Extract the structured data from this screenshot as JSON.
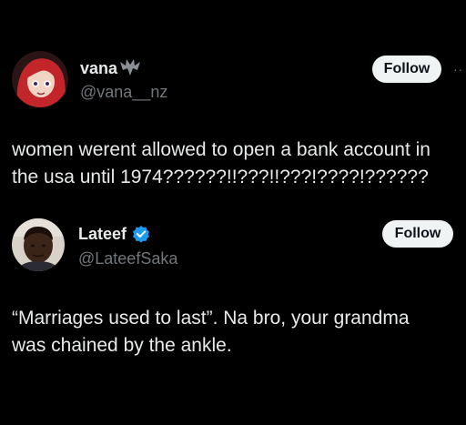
{
  "tweets": [
    {
      "name": "vana",
      "handle": "@vana__nz",
      "follow_label": "Follow",
      "text_line1": "women werent allowed to open a bank account in",
      "text_line2": "the usa until 1974??????!!???!!???!????!??????",
      "badge_icon": "bat-emoji-icon",
      "avatar_icon": "anime-avatar-red-hair"
    },
    {
      "name": "Lateef",
      "handle": "@LateefSaka",
      "follow_label": "Follow",
      "text_line1": "“Marriages used to last”. Na bro, your grandma",
      "text_line2": "was chained by the ankle.",
      "badge_icon": "verified-badge-icon",
      "badge_color": "#1d9bf0",
      "avatar_icon": "profile-photo-avatar"
    }
  ],
  "more_label": "··"
}
